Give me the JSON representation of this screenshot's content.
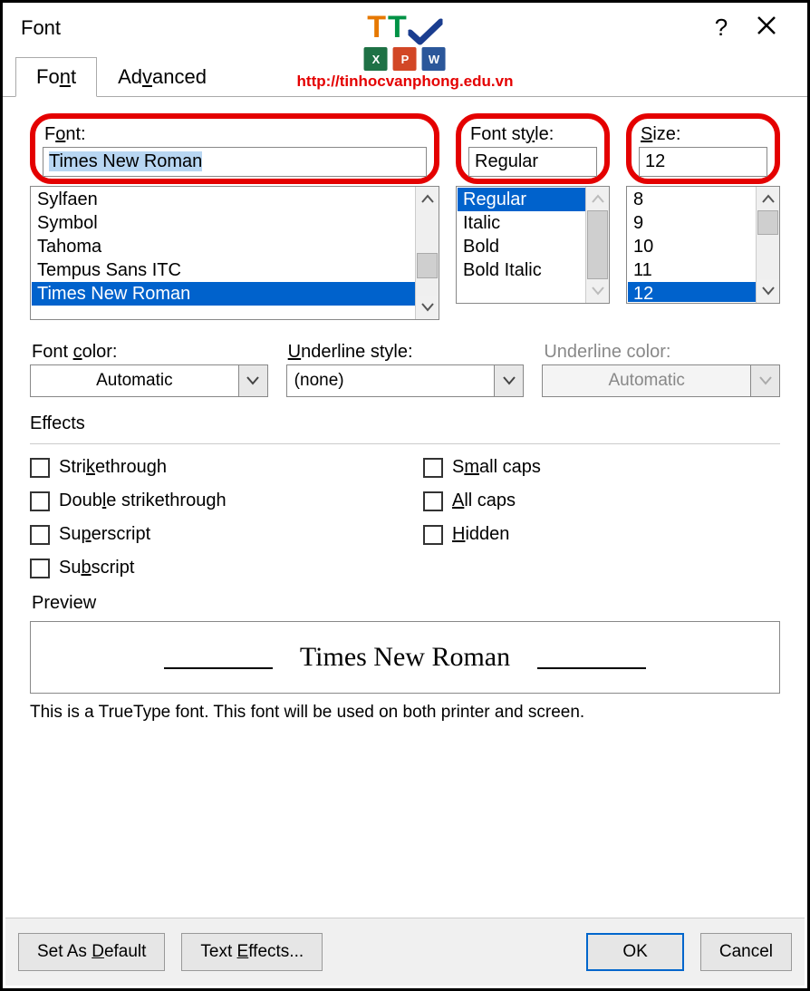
{
  "title": "Font",
  "watermark_url": "http://tinhocvanphong.edu.vn",
  "tabs": {
    "font": "Font",
    "advanced": "Advanced"
  },
  "font": {
    "label_pre": "F",
    "label_u": "o",
    "label_post": "nt:",
    "value": "Times New Roman",
    "list": [
      "Sylfaen",
      "Symbol",
      "Tahoma",
      "Tempus Sans ITC",
      "Times New Roman"
    ]
  },
  "style": {
    "label": "Font style:",
    "value": "Regular",
    "list": [
      "Regular",
      "Italic",
      "Bold",
      "Bold Italic"
    ]
  },
  "size": {
    "label_u": "S",
    "label_post": "ize:",
    "value": "12",
    "list": [
      "8",
      "9",
      "10",
      "11",
      "12"
    ]
  },
  "fontcolor": {
    "label_pre": "Font ",
    "label_u": "c",
    "label_post": "olor:",
    "value": "Automatic"
  },
  "underlinestyle": {
    "label_u": "U",
    "label_post": "nderline style:",
    "value": "(none)"
  },
  "underlinecolor": {
    "label": "Underline color:",
    "value": "Automatic"
  },
  "effects": {
    "legend": "Effects",
    "strike_u": "k",
    "strike_pre": "Stri",
    "strike_post": "ethrough",
    "dstrike_pre": "Doub",
    "dstrike_u": "l",
    "dstrike_post": "e strikethrough",
    "super_pre": "Su",
    "super_u": "p",
    "super_post": "erscript",
    "sub_pre": "Su",
    "sub_u": "b",
    "sub_post": "script",
    "small_pre": "S",
    "small_u": "m",
    "small_post": "all caps",
    "all_u": "A",
    "all_post": "ll caps",
    "hidden_u": "H",
    "hidden_post": "idden"
  },
  "preview": {
    "legend": "Preview",
    "text": "Times New Roman",
    "note": "This is a TrueType font. This font will be used on both printer and screen."
  },
  "buttons": {
    "setdefault_pre": "Set As ",
    "setdefault_u": "D",
    "setdefault_post": "efault",
    "texteffects_pre": "Text ",
    "texteffects_u": "E",
    "texteffects_post": "ffects...",
    "ok": "OK",
    "cancel": "Cancel"
  }
}
